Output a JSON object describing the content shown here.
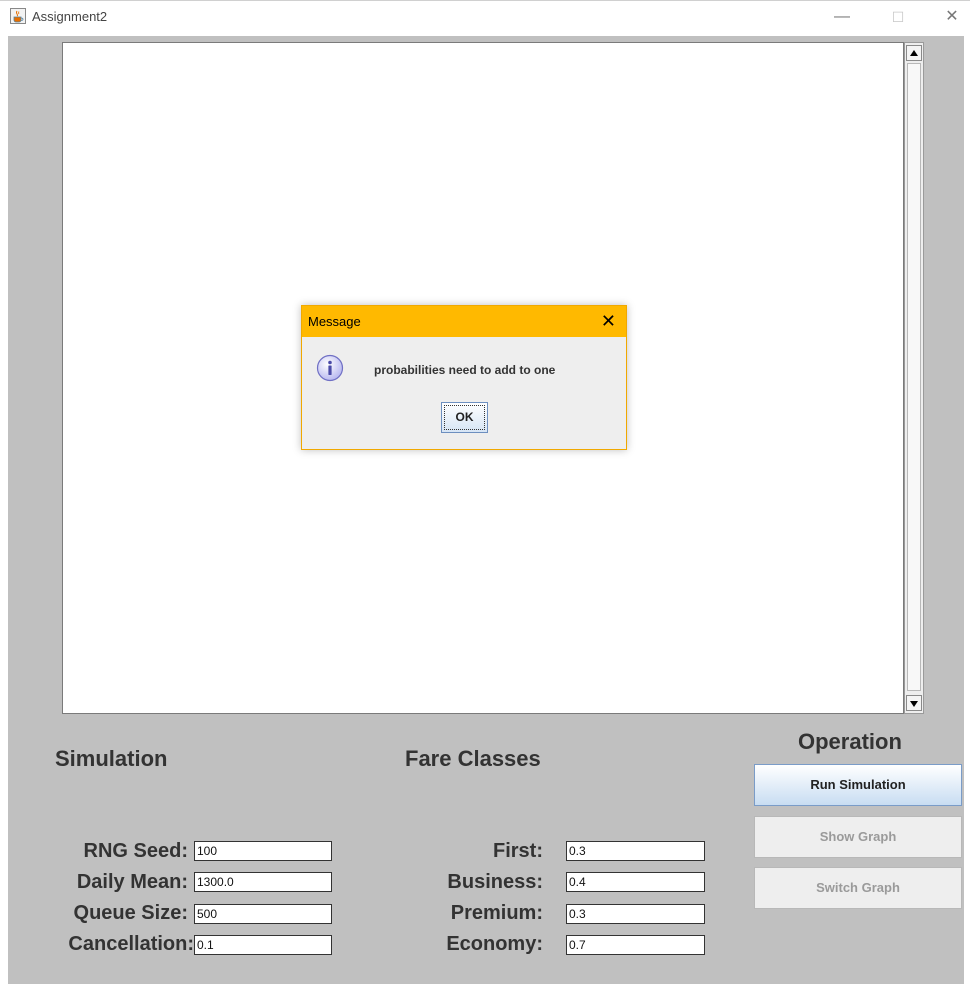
{
  "window": {
    "title": "Assignment2",
    "minimize_glyph": "—",
    "maximize_glyph": "☐",
    "close_glyph": "✕"
  },
  "simulation": {
    "heading": "Simulation",
    "rng_seed_label": "RNG Seed:",
    "rng_seed_value": "100",
    "daily_mean_label": "Daily Mean:",
    "daily_mean_value": "1300.0",
    "queue_size_label": "Queue Size:",
    "queue_size_value": "500",
    "cancellation_label": "Cancellation:",
    "cancellation_value": "0.1"
  },
  "fare_classes": {
    "heading": "Fare Classes",
    "first_label": "First:",
    "first_value": "0.3",
    "business_label": "Business:",
    "business_value": "0.4",
    "premium_label": "Premium:",
    "premium_value": "0.3",
    "economy_label": "Economy:",
    "economy_value": "0.7"
  },
  "operation": {
    "heading": "Operation",
    "run_label": "Run Simulation",
    "show_graph_label": "Show Graph",
    "switch_graph_label": "Switch Graph"
  },
  "dialog": {
    "title": "Message",
    "close_glyph": "✕",
    "message": "probabilities need to add to one",
    "ok_label": "OK"
  },
  "colors": {
    "frame_bg": "#c0c0c0",
    "dialog_title_bg": "#ffb900",
    "primary_button_border": "#7a9cc8"
  },
  "icons": {
    "app": "java-cup-icon",
    "dialog": "info-icon"
  }
}
